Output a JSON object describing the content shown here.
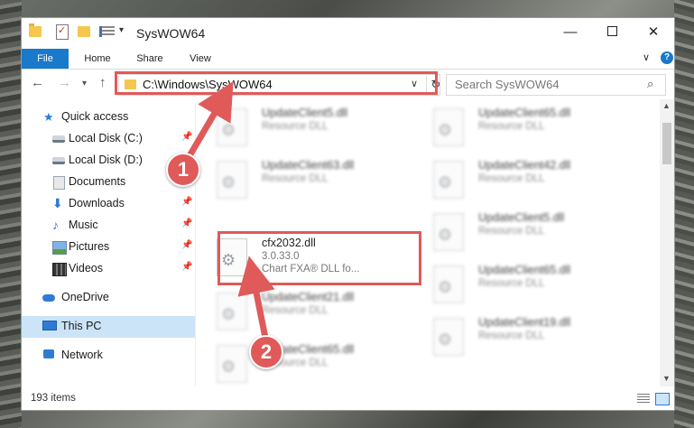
{
  "window": {
    "title": "SysWOW64"
  },
  "title_buttons": {
    "minimize": "—",
    "maximize": "",
    "close": "✕"
  },
  "ribbon": {
    "tabs": [
      "File",
      "Home",
      "Share",
      "View"
    ],
    "help": "?"
  },
  "nav": {
    "address": "C:\\Windows\\SysWOW64",
    "search_placeholder": "Search SysWOW64"
  },
  "sidebar": {
    "items": [
      {
        "label": "Quick access",
        "icon": "star-icon",
        "pinned": false
      },
      {
        "label": "Local Disk (C:)",
        "icon": "disk-icon",
        "pinned": true
      },
      {
        "label": "Local Disk (D:)",
        "icon": "disk-icon",
        "pinned": false
      },
      {
        "label": "Documents",
        "icon": "documents-icon",
        "pinned": true
      },
      {
        "label": "Downloads",
        "icon": "download-icon",
        "pinned": true
      },
      {
        "label": "Music",
        "icon": "music-icon",
        "pinned": true
      },
      {
        "label": "Pictures",
        "icon": "pictures-icon",
        "pinned": true
      },
      {
        "label": "Videos",
        "icon": "videos-icon",
        "pinned": true
      },
      {
        "label": "OneDrive",
        "icon": "onedrive-icon",
        "pinned": false
      },
      {
        "label": "This PC",
        "icon": "pc-icon",
        "pinned": false,
        "selected": true
      },
      {
        "label": "Network",
        "icon": "network-icon",
        "pinned": false
      }
    ]
  },
  "files": [
    {
      "name": "UpdateClient5.dll",
      "line1": "Resource DLL",
      "line2": "",
      "blurred": true
    },
    {
      "name": "UpdateClient65.dll",
      "line1": "Resource DLL",
      "line2": "",
      "blurred": true
    },
    {
      "name": "UpdateClient63.dll",
      "line1": "Resource DLL",
      "line2": "",
      "blurred": true
    },
    {
      "name": "UpdateClient42.dll",
      "line1": "Resource DLL",
      "line2": "",
      "blurred": true
    },
    {
      "name": "cfx2032.dll",
      "line1": "3.0.33.0",
      "line2": "Chart FXA® DLL fo...",
      "blurred": false
    },
    {
      "name": "UpdateClient5.dll",
      "line1": "Resource DLL",
      "line2": "",
      "blurred": true
    },
    {
      "name": "UpdateClient21.dll",
      "line1": "Resource DLL",
      "line2": "",
      "blurred": true
    },
    {
      "name": "UpdateClient65.dll",
      "line1": "Resource DLL",
      "line2": "",
      "blurred": true
    },
    {
      "name": "UpdateClient65.dll",
      "line1": "Resource DLL",
      "line2": "",
      "blurred": true
    },
    {
      "name": "UpdateClient19.dll",
      "line1": "Resource DLL",
      "line2": "",
      "blurred": true
    }
  ],
  "status": {
    "item_count": "193 items"
  },
  "annotations": {
    "step1": "1",
    "step2": "2",
    "color": "#e05a5a"
  }
}
